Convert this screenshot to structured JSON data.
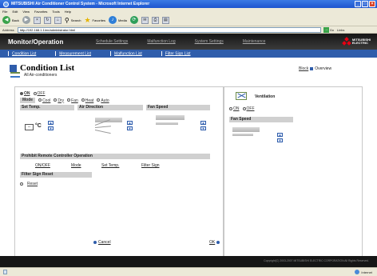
{
  "window": {
    "title": "MITSUBISHI Air Conditioner Control System - Microsoft Internet Explorer"
  },
  "browser": {
    "menu": [
      "File",
      "Edit",
      "View",
      "Favorites",
      "Tools",
      "Help"
    ],
    "back_label": "Back",
    "search_label": "Search",
    "favorites_label": "Favorites",
    "media_label": "Media",
    "address_label": "Address",
    "address": "http://192.168.1.1/en/administrator.html",
    "go_label": "Go",
    "links_label": "Links",
    "status_zone": "Internet"
  },
  "app": {
    "title": "Monitor/Operation",
    "nav_tabs": [
      "Schedule Settings",
      "Malfunction Log",
      "System Settings",
      "Maintenance"
    ],
    "brand": [
      "MITSUBISHI",
      "ELECTRIC"
    ],
    "sub_nav": [
      "Condition List",
      "Measurement List",
      "Malfunction List",
      "Filter Sign List"
    ]
  },
  "page": {
    "title": "Condition List",
    "group_label": "All Air-conditioners",
    "block_label": "Block",
    "overview_label": "Overview"
  },
  "left_panel": {
    "on_label": "ON",
    "off_label": "OFF",
    "mode_label": "Mode",
    "modes": [
      "Cool",
      "Dry",
      "Fan",
      "Heat",
      "Auto"
    ],
    "set_temp_label": "Set Temp.",
    "temp_value": "--",
    "temp_unit": "°C",
    "air_direction_label": "Air Direction",
    "fan_speed_label": "Fan Speed",
    "prohibit_label": "Prohibit Remote Controller Operation",
    "prohibit_items": [
      "ON/OFF",
      "Mode",
      "Set Temp.",
      "Filter Sign"
    ],
    "filter_reset_label": "Filter Sign Reset",
    "reset_label": "Reset"
  },
  "right_panel": {
    "ventilation_label": "Ventilation",
    "on_label": "ON",
    "off_label": "OFF",
    "fan_speed_label": "Fan Speed"
  },
  "actions": {
    "cancel": "Cancel",
    "ok": "OK"
  },
  "footer": {
    "copyright": "Copyright(C) 2003-2007 MITSUBISHI ELECTRIC CORPORATION All Rights Reserved."
  },
  "colors": {
    "header_dark": "#161616",
    "nav_blue": "#2f5dab",
    "brand_red": "#e60012"
  }
}
